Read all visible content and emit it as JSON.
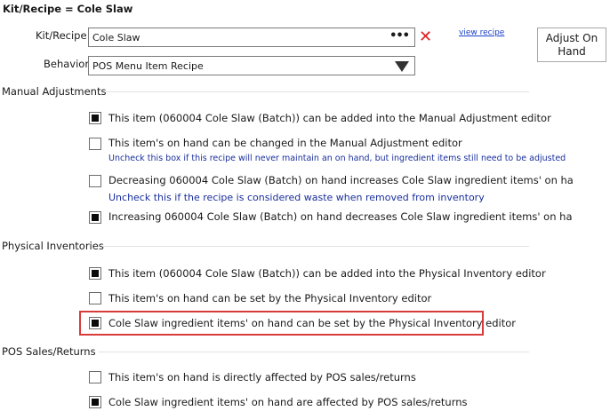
{
  "header": {
    "title": "Kit/Recipe = Cole Slaw"
  },
  "kit_recipe": {
    "label": "Kit/Recipe",
    "value": "Cole Slaw",
    "more": "•••",
    "clear": "✕",
    "view_link": "view recipe"
  },
  "behavior": {
    "label": "Behavior",
    "value": "POS Menu Item Recipe"
  },
  "adjust_button": {
    "line1": "Adjust On",
    "line2": "Hand"
  },
  "manual": {
    "heading": "Manual Adjustments",
    "items": [
      {
        "label": "This item (060004 Cole Slaw (Batch)) can be added into the Manual Adjustment editor",
        "checked": true
      },
      {
        "label": "This item's on hand can be changed in the Manual Adjustment editor",
        "note": "Uncheck this box if this recipe will never maintain an on hand, but ingredient items still need to be adjusted",
        "checked": false
      },
      {
        "label": "Decreasing 060004 Cole Slaw (Batch) on hand increases Cole Slaw ingredient items' on ha",
        "note": "Uncheck this if the recipe is considered waste when removed from inventory",
        "checked": false
      },
      {
        "label": "Increasing 060004 Cole Slaw (Batch) on hand decreases Cole Slaw ingredient items' on ha",
        "checked": true
      }
    ]
  },
  "physical": {
    "heading": "Physical Inventories",
    "items": [
      {
        "label": "This item (060004 Cole Slaw (Batch)) can be added into the Physical Inventory editor",
        "checked": true
      },
      {
        "label": "This item's on hand can be set by the Physical Inventory editor",
        "checked": false
      },
      {
        "label": "Cole Slaw ingredient items' on hand can be set by the Physical Inventory editor",
        "checked": true
      }
    ]
  },
  "pos": {
    "heading": "POS Sales/Returns",
    "items": [
      {
        "label": "This item's on hand is directly affected by POS sales/returns",
        "checked": false
      },
      {
        "label": "Cole Slaw ingredient items' on hand are affected by POS sales/returns",
        "checked": true
      }
    ]
  }
}
